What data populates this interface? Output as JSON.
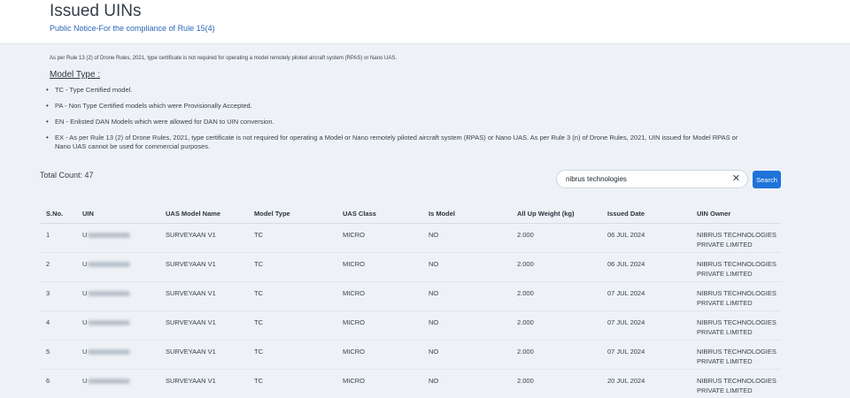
{
  "header": {
    "title": "Issued UINs",
    "subtitle_link": "Public Notice-For the compliance of Rule 15(4)"
  },
  "notice": {
    "intro": "As per Rule 13 (2) of Drone Rules, 2021, type certificate is not required for operating a model remotely piloted aircraft system (RPAS) or Nano UAS.",
    "model_type_heading": "Model Type :",
    "bullets": [
      "TC - Type Certified model.",
      "PA - Non Type Certified models which were Provisionally Accepted.",
      "EN - Enlisted DAN Models which were allowed for DAN to UIN conversion.",
      "EX - As per Rule 13 (2) of Drone Rules, 2021, type certificate is not required for operating a Model or Nano remotely piloted aircraft system (RPAS) or Nano UAS. As per Rule 3 (n) of Drone Rules, 2021, UIN issued for Model RPAS or Nano UAS cannot be used for commercial purposes."
    ]
  },
  "total_count": "Total Count: 47",
  "search": {
    "value": "nibrus technologies",
    "clear_icon": "close-icon",
    "button_label": "Search"
  },
  "table": {
    "columns": [
      "S.No.",
      "UIN",
      "UAS Model Name",
      "Model Type",
      "UAS Class",
      "Is Model",
      "All Up Weight (kg)",
      "Issued Date",
      "UIN Owner"
    ],
    "rows": [
      {
        "sno": "1",
        "uin": "U",
        "model": "SURVEYAAN V1",
        "type": "TC",
        "class": "MICRO",
        "is_model": "NO",
        "weight": "2.000",
        "date": "06 JUL 2024",
        "owner": "NIBRUS TECHNOLOGIES PRIVATE LIMITED"
      },
      {
        "sno": "2",
        "uin": "U",
        "model": "SURVEYAAN V1",
        "type": "TC",
        "class": "MICRO",
        "is_model": "NO",
        "weight": "2.000",
        "date": "06 JUL 2024",
        "owner": "NIBRUS TECHNOLOGIES PRIVATE LIMITED"
      },
      {
        "sno": "3",
        "uin": "U",
        "model": "SURVEYAAN V1",
        "type": "TC",
        "class": "MICRO",
        "is_model": "NO",
        "weight": "2.000",
        "date": "07 JUL 2024",
        "owner": "NIBRUS TECHNOLOGIES PRIVATE LIMITED"
      },
      {
        "sno": "4",
        "uin": "U",
        "model": "SURVEYAAN V1",
        "type": "TC",
        "class": "MICRO",
        "is_model": "NO",
        "weight": "2.000",
        "date": "07 JUL 2024",
        "owner": "NIBRUS TECHNOLOGIES PRIVATE LIMITED"
      },
      {
        "sno": "5",
        "uin": "U",
        "model": "SURVEYAAN V1",
        "type": "TC",
        "class": "MICRO",
        "is_model": "NO",
        "weight": "2.000",
        "date": "07 JUL 2024",
        "owner": "NIBRUS TECHNOLOGIES PRIVATE LIMITED"
      },
      {
        "sno": "6",
        "uin": "U",
        "model": "SURVEYAAN V1",
        "type": "TC",
        "class": "MICRO",
        "is_model": "NO",
        "weight": "2.000",
        "date": "20 JUL 2024",
        "owner": "NIBRUS TECHNOLOGIES PRIVATE LIMITED"
      }
    ]
  },
  "colors": {
    "accent": "#1f73d8",
    "link": "#2b66b8",
    "background": "#eef2f7"
  }
}
